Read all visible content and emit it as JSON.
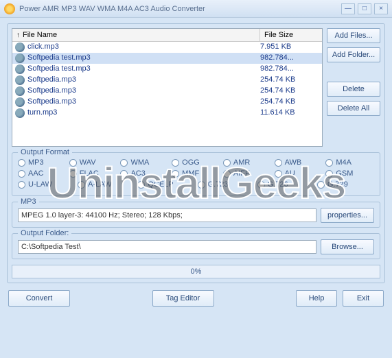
{
  "title": "Power AMR MP3 WAV WMA M4A AC3 Audio Converter",
  "columns": {
    "name": "File Name",
    "size": "File Size"
  },
  "files": [
    {
      "name": "click.mp3",
      "size": "7.951 KB",
      "sel": false
    },
    {
      "name": "Softpedia test.mp3",
      "size": "982.784...",
      "sel": true
    },
    {
      "name": "Softpedia test.mp3",
      "size": "982.784...",
      "sel": false
    },
    {
      "name": "Softpedia.mp3",
      "size": "254.74 KB",
      "sel": false
    },
    {
      "name": "Softpedia.mp3",
      "size": "254.74 KB",
      "sel": false
    },
    {
      "name": "Softpedia.mp3",
      "size": "254.74 KB",
      "sel": false
    },
    {
      "name": "turn.mp3",
      "size": "11.614 KB",
      "sel": false
    }
  ],
  "buttons": {
    "addFiles": "Add Files...",
    "addFolder": "Add Folder...",
    "delete": "Delete",
    "deleteAll": "Delete All",
    "properties": "properties...",
    "browse": "Browse...",
    "convert": "Convert",
    "tagEditor": "Tag Editor",
    "help": "Help",
    "exit": "Exit"
  },
  "groups": {
    "outputFormat": "Output Format",
    "mp3": "MP3",
    "outputFolder": "Output Folder:"
  },
  "formats": {
    "row1": [
      "MP3",
      "WAV",
      "WMA",
      "OGG",
      "AMR",
      "AWB",
      "M4A"
    ],
    "row2": [
      "AAC",
      "FLAC",
      "AC3",
      "MMF",
      "AIFF",
      "AU",
      "GSM"
    ],
    "row3": [
      "U-LAW",
      "A-LAW",
      "QCELP",
      "G.723",
      "G.726",
      "G.729"
    ]
  },
  "mp3Info": "MPEG 1.0 layer-3: 44100 Hz; Stereo;  128 Kbps;",
  "outputPath": "C:\\Softpedia Test\\",
  "progress": "0%",
  "watermark": "UninstallGeeks"
}
